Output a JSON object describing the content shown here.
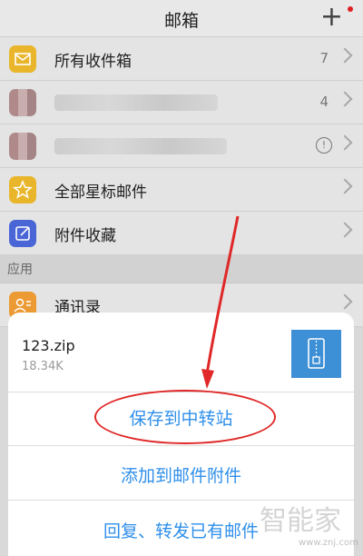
{
  "header": {
    "title": "邮箱"
  },
  "mailbox_rows": [
    {
      "label": "所有收件箱",
      "count": "7",
      "icon": "inbox-icon",
      "color": "#e9b62b"
    },
    {
      "label": "",
      "count": "4",
      "icon": "blurred-avatar",
      "color": "#b08a8a"
    },
    {
      "label": "",
      "count": "",
      "icon": "blurred-avatar",
      "color": "#b08a8a"
    },
    {
      "label": "全部星标邮件",
      "count": "",
      "icon": "star-icon",
      "color": "#e9b62b"
    },
    {
      "label": "附件收藏",
      "count": "",
      "icon": "attachment-icon",
      "color": "#4a66d6"
    }
  ],
  "section_apps": {
    "label": "应用"
  },
  "contacts": {
    "label": "通讯录",
    "color": "#ec9a34"
  },
  "sheet": {
    "file_name": "123.zip",
    "file_size": "18.34K",
    "actions": [
      {
        "label": "保存到中转站"
      },
      {
        "label": "添加到邮件附件"
      },
      {
        "label": "回复、转发已有邮件"
      }
    ]
  },
  "watermark": {
    "brand": "智能家",
    "url": "www.znj.com"
  },
  "colors": {
    "accent": "#2f8fea",
    "annotation": "#e02828",
    "zip_tile": "#3d8fd6"
  }
}
